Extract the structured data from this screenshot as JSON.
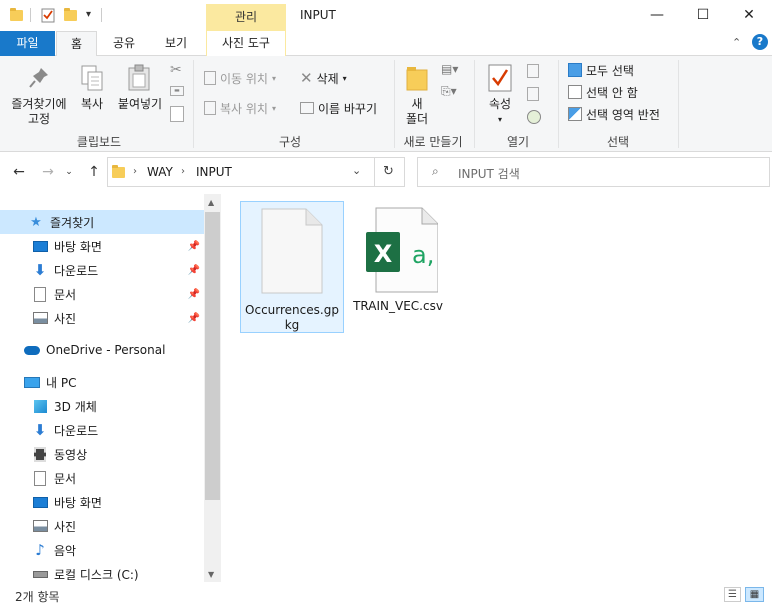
{
  "window": {
    "title": "INPUT",
    "manage_tab": "관리",
    "minimize": "—",
    "maximize": "☐",
    "close": "✕"
  },
  "tabs": {
    "file": "파일",
    "home": "홈",
    "share": "공유",
    "view": "보기",
    "picture_tools": "사진 도구"
  },
  "ribbon": {
    "clipboard": {
      "pin_quick_line1": "즐겨찾기에",
      "pin_quick_line2": "고정",
      "copy": "복사",
      "paste": "붙여넣기",
      "group_label": "클립보드"
    },
    "organize": {
      "move_to": "이동 위치",
      "copy_to": "복사 위치",
      "delete": "삭제",
      "rename": "이름 바꾸기",
      "group_label": "구성"
    },
    "new": {
      "new_folder_line1": "새",
      "new_folder_line2": "폴더",
      "group_label": "새로 만들기"
    },
    "open": {
      "properties": "속성",
      "group_label": "열기"
    },
    "select": {
      "select_all": "모두 선택",
      "select_none": "선택 안 함",
      "invert": "선택 영역 반전",
      "group_label": "선택"
    }
  },
  "address": {
    "crumbs": [
      "WAY",
      "INPUT"
    ],
    "search_placeholder": "INPUT 검색"
  },
  "nav_pane": {
    "quick_access": "즐겨찾기",
    "quick_items": [
      "바탕 화면",
      "다운로드",
      "문서",
      "사진"
    ],
    "onedrive": "OneDrive - Personal",
    "this_pc": "내 PC",
    "pc_items": [
      "3D 개체",
      "다운로드",
      "동영상",
      "문서",
      "바탕 화면",
      "사진",
      "음악",
      "로컬 디스크 (C:)"
    ]
  },
  "files": [
    {
      "name": "Occurrences.gpkg",
      "type": "generic"
    },
    {
      "name": "TRAIN_VEC.csv",
      "type": "excel-csv"
    }
  ],
  "status": {
    "count": "2개 항목"
  },
  "colors": {
    "accent_blue": "#1979ca",
    "manage_yellow": "#fbe9a0",
    "excel_green": "#1d7044"
  }
}
